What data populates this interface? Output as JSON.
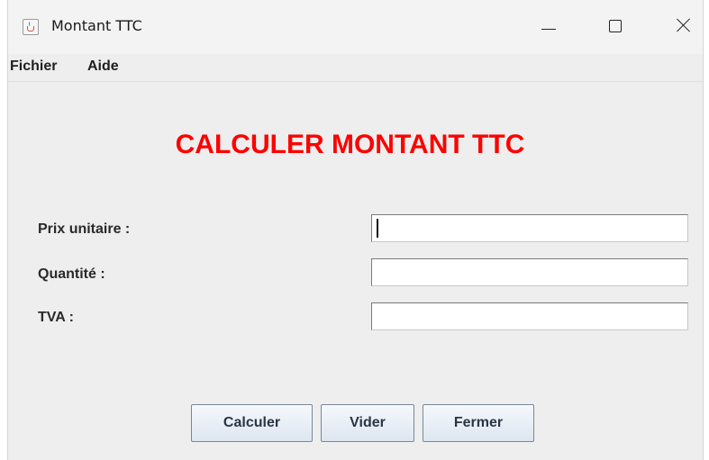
{
  "window": {
    "title": "Montant TTC",
    "icon": "java-cup-icon",
    "controls": [
      "minimize-icon",
      "maximize-icon",
      "close-icon"
    ]
  },
  "menubar": {
    "items": [
      {
        "label": "Fichier"
      },
      {
        "label": "Aide"
      }
    ]
  },
  "form": {
    "heading": "CALCULER MONTANT TTC",
    "heading_color": "#ff0000",
    "fields": [
      {
        "label": "Prix unitaire :",
        "value": ""
      },
      {
        "label": "Quantité :",
        "value": ""
      },
      {
        "label": "TVA :",
        "value": ""
      }
    ]
  },
  "buttons": {
    "calculate": "Calculer",
    "clear": "Vider",
    "close": "Fermer"
  }
}
